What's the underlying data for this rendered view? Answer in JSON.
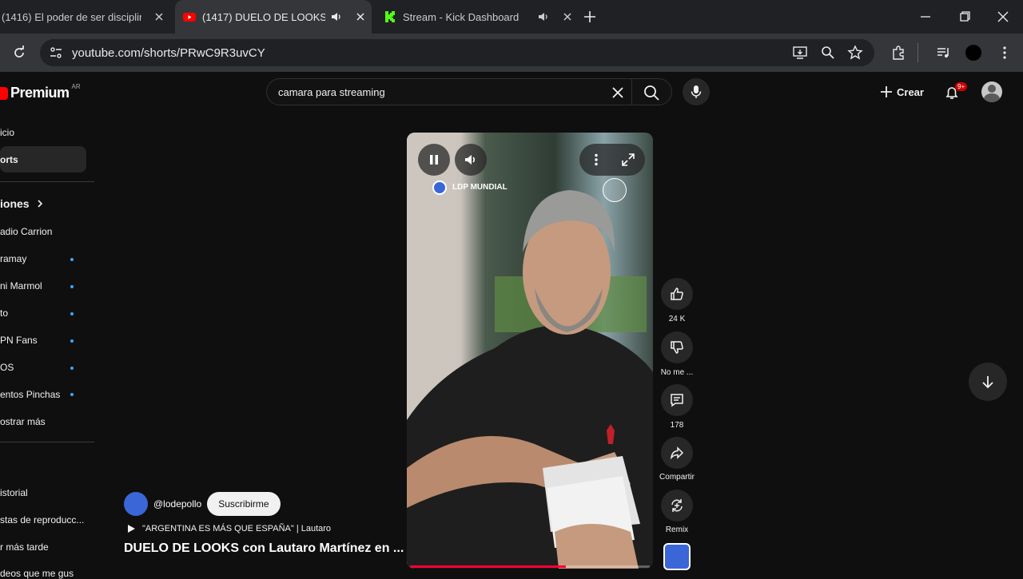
{
  "browser": {
    "tabs": [
      {
        "title": "(1416) El poder de ser disciplina",
        "active": false,
        "icon": "youtube-icon"
      },
      {
        "title": "(1417) DUELO DE LOOKS co",
        "active": true,
        "icon": "youtube-icon"
      },
      {
        "title": "Stream - Kick Dashboard",
        "active": false,
        "icon": "kick-icon"
      }
    ],
    "url": "youtube.com/shorts/PRwC9R3uvCY"
  },
  "youtube": {
    "logo": {
      "text": "Premium",
      "region": "AR"
    },
    "search": {
      "value": "camara para streaming"
    },
    "create_label": "Crear",
    "notifications_badge": "9+",
    "sidebar": {
      "items": [
        {
          "label": "icio"
        },
        {
          "label": "orts"
        },
        {
          "label": "iones"
        },
        {
          "label": "adio Carrion"
        },
        {
          "label": "ramay"
        },
        {
          "label": "ni Marmol"
        },
        {
          "label": "to"
        },
        {
          "label": "PN Fans"
        },
        {
          "label": "OS"
        },
        {
          "label": "entos Pinchas"
        },
        {
          "label": "ostrar más"
        },
        {
          "label": "istorial"
        },
        {
          "label": "stas de reproducc..."
        },
        {
          "label": "r más tarde"
        },
        {
          "label": "deos que me gus"
        }
      ]
    },
    "video": {
      "overlay_channel": "LDP MUNDIAL",
      "progress": 0.65
    },
    "actions": {
      "likes": "24 K",
      "dislike_label": "No me ...",
      "comments": "178",
      "share_label": "Compartir",
      "remix_label": "Remix"
    },
    "channel": {
      "handle": "@lodepollo",
      "subscribe_label": "Suscribirme"
    },
    "playlist_text": "\"ARGENTINA ES MÁS QUE ESPAÑA\" | Lautaro",
    "title": "DUELO DE LOOKS con Lautaro Martínez en ..."
  }
}
